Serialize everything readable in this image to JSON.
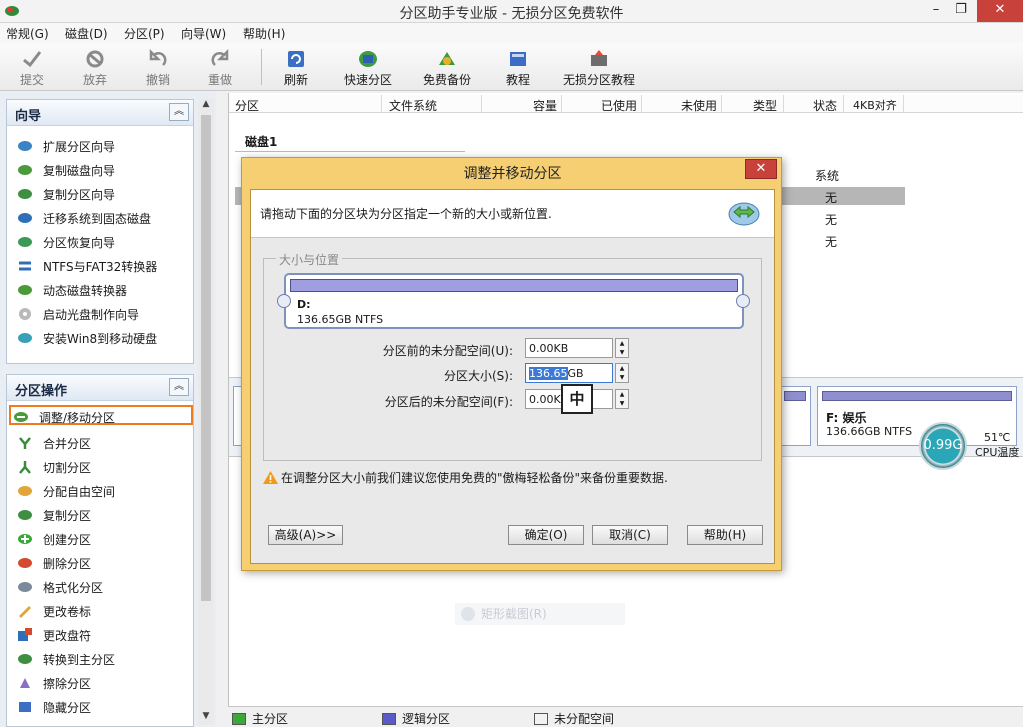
{
  "window": {
    "title": "分区助手专业版 - 无损分区免费软件",
    "minimize": "–",
    "restore": "❐",
    "close": "✕"
  },
  "menu": [
    "常规(G)",
    "磁盘(D)",
    "分区(P)",
    "向导(W)",
    "帮助(H)"
  ],
  "toolbar": {
    "submit": "提交",
    "discard": "放弃",
    "undo": "撤销",
    "redo": "重做",
    "refresh": "刷新",
    "quick_partition": "快速分区",
    "free_backup": "免费备份",
    "tutorial": "教程",
    "lossless_tutorial": "无损分区教程"
  },
  "wizard_panel": {
    "title": "向导",
    "collapse": "︽",
    "items": [
      "扩展分区向导",
      "复制磁盘向导",
      "复制分区向导",
      "迁移系统到固态磁盘",
      "分区恢复向导",
      "NTFS与FAT32转换器",
      "动态磁盘转换器",
      "启动光盘制作向导",
      "安装Win8到移动硬盘"
    ]
  },
  "partition_panel": {
    "title": "分区操作",
    "collapse": "︽",
    "items": [
      "调整/移动分区",
      "合并分区",
      "切割分区",
      "分配自由空间",
      "复制分区",
      "创建分区",
      "删除分区",
      "格式化分区",
      "更改卷标",
      "更改盘符",
      "转换到主分区",
      "擦除分区",
      "隐藏分区"
    ]
  },
  "scroll": {
    "up": "▲",
    "down": "▼"
  },
  "columns": [
    "分区",
    "文件系统",
    "容量",
    "已使用",
    "未使用",
    "类型",
    "状态",
    "4KB对齐"
  ],
  "disk": {
    "label": "磁盘1",
    "status_values": [
      "系统",
      "无",
      "无",
      "无"
    ]
  },
  "disk_map": {
    "partitions": [
      {
        "name": "F: 娱乐",
        "size": "136.66GB NTFS"
      }
    ]
  },
  "cpu": {
    "usage": "0.99G",
    "temp": "51℃",
    "temp_label": "CPU温度"
  },
  "snip_hint": "矩形截图(R)",
  "legend": {
    "primary": "主分区",
    "logical": "逻辑分区",
    "unallocated": "未分配空间",
    "colors": {
      "primary": "#3aa83a",
      "logical": "#5a5ac8",
      "unallocated": "#f2f2f2"
    }
  },
  "dialog": {
    "title": "调整并移动分区",
    "close": "✕",
    "info": "请拖动下面的分区块为分区指定一个新的大小或新位置.",
    "group_label": "大小与位置",
    "partition_name": "D:",
    "partition_size": "136.65GB NTFS",
    "before_label": "分区前的未分配空间(U):",
    "before_value": "0.00KB",
    "size_label": "分区大小(S):",
    "size_value_selected": "136.65",
    "size_value_unit": "GB",
    "after_label": "分区后的未分配空间(F):",
    "after_value": "0.00KB",
    "ime_indicator": "中",
    "warning": "在调整分区大小前我们建议您使用免费的\"傲梅轻松备份\"来备份重要数据.",
    "advanced_button": "高级(A)>>",
    "ok_button": "确定(O)",
    "cancel_button": "取消(C)",
    "help_button": "帮助(H)"
  }
}
